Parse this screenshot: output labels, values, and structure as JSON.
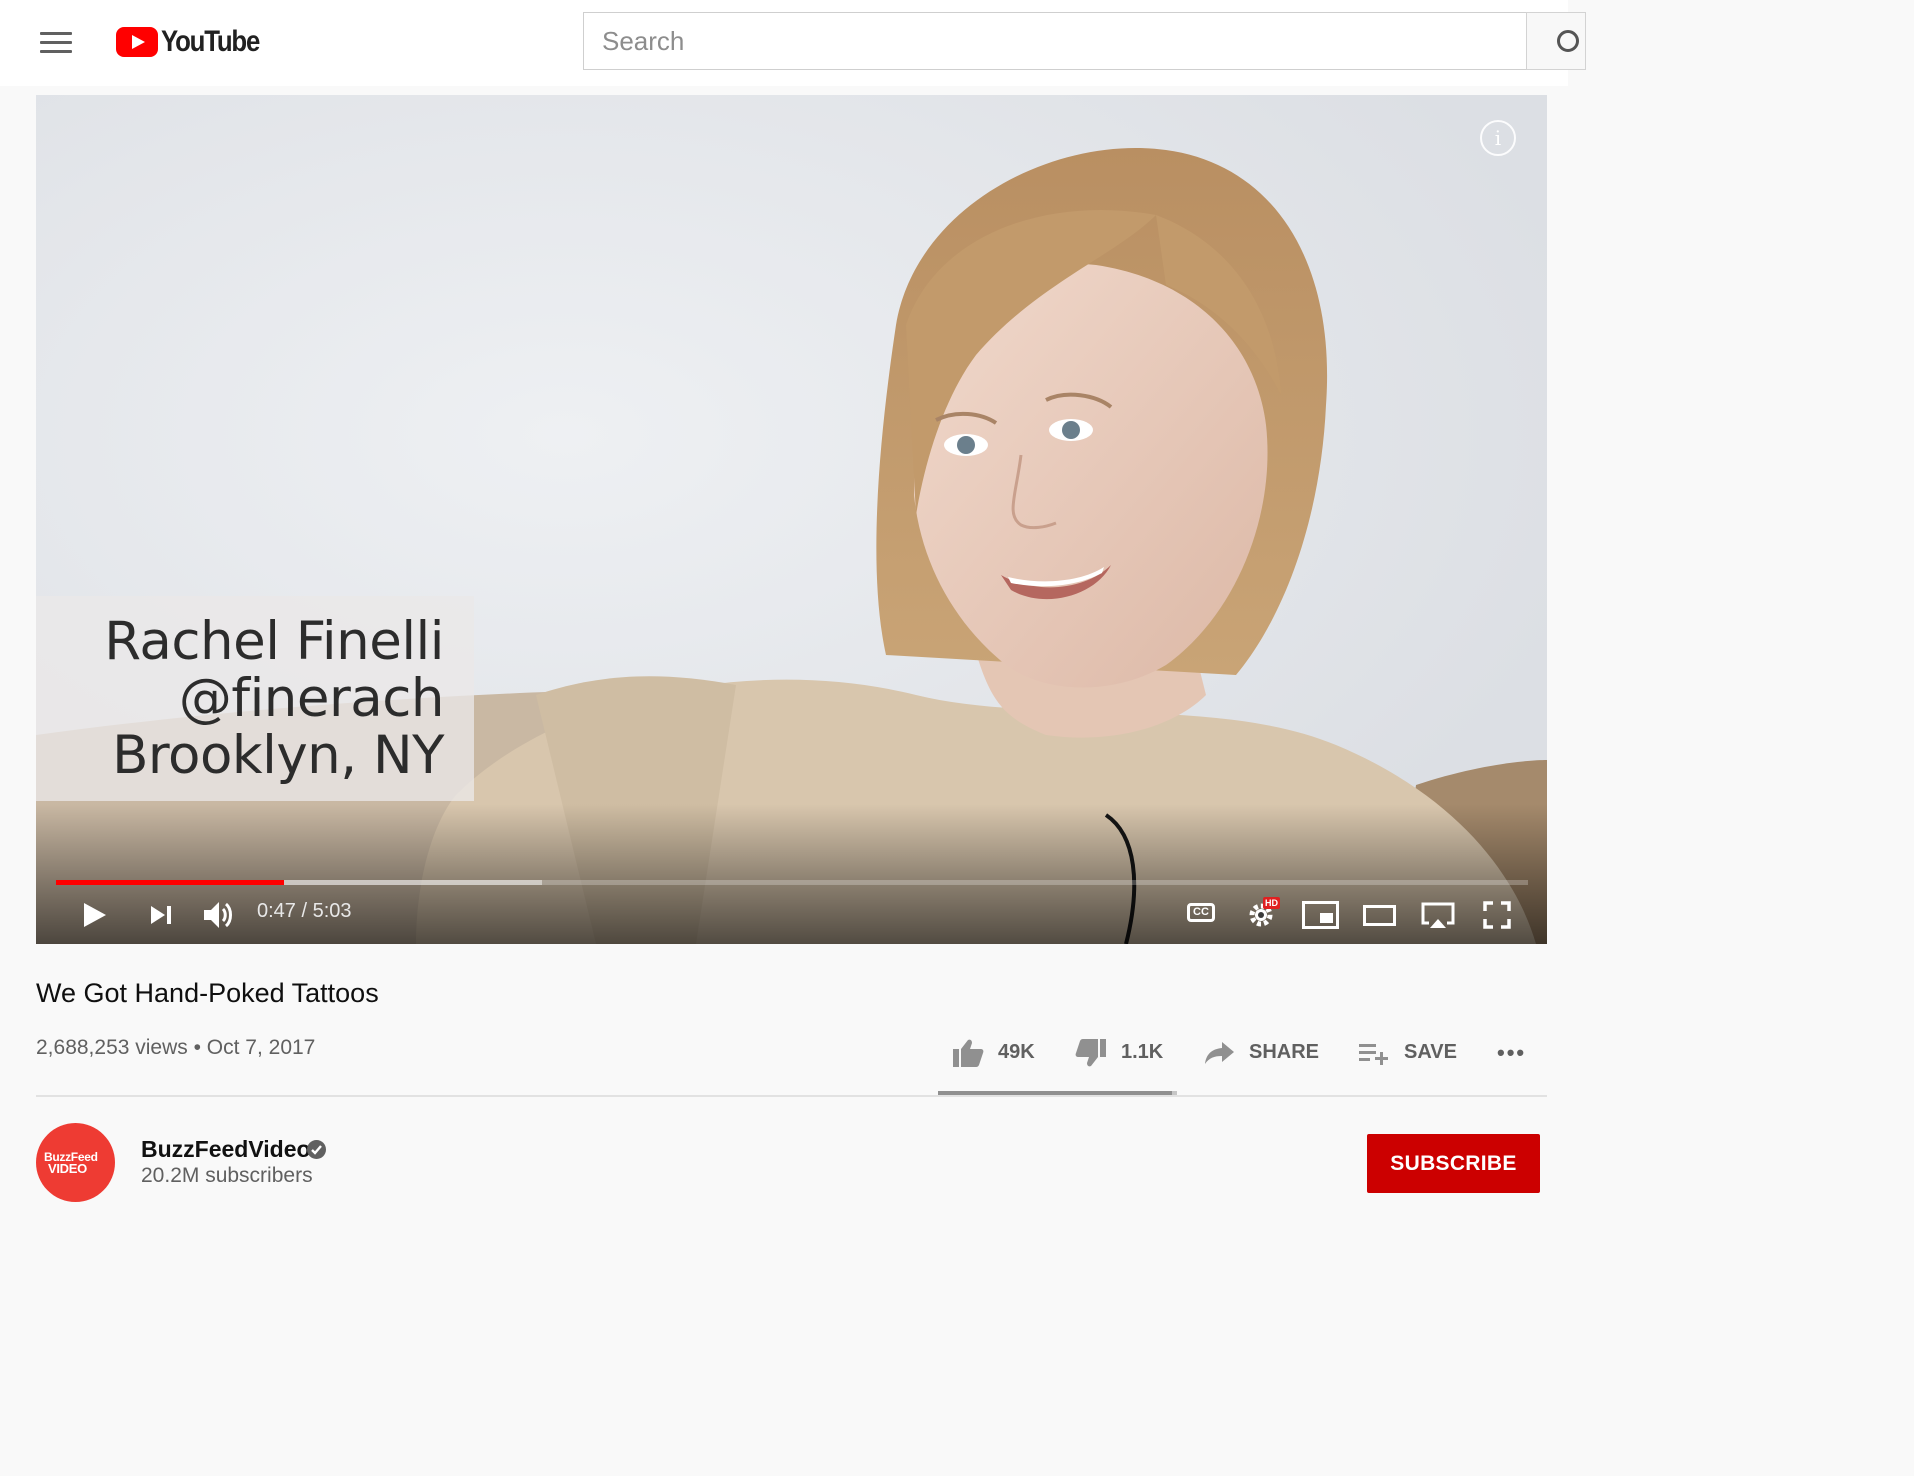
{
  "masthead": {
    "logo_text": "YouTube",
    "search_placeholder": "Search"
  },
  "player": {
    "lower_third": [
      "Rachel Finelli",
      "@finerach",
      "Brooklyn, NY"
    ],
    "info_label": "i",
    "current_time": "0:47",
    "duration": "5:03",
    "time_display": "0:47 / 5:03",
    "progress_fraction": 0.155,
    "buffered_fraction": 0.33,
    "cc_label": "CC",
    "quality_badge": "HD"
  },
  "video": {
    "title": "We Got Hand-Poked Tattoos",
    "views": "2,688,253 views",
    "separator": "•",
    "date": "Oct 7, 2017",
    "meta_line": "2,688,253 views • Oct 7, 2017",
    "likes": "49K",
    "dislikes": "1.1K",
    "share_label": "SHARE",
    "save_label": "SAVE",
    "more_label": "•••",
    "like_ratio": 0.978
  },
  "channel": {
    "name": "BuzzFeedVideo",
    "subscribers": "20.2M subscribers",
    "avatar_line1": "BuzzFeed",
    "avatar_line2": "VIDEO",
    "subscribe_label": "SUBSCRIBE"
  },
  "colors": {
    "brand_red": "#ff0000",
    "subscribe_red": "#cc0000",
    "avatar_red": "#ee3b33",
    "progress_red": "#ff0000"
  },
  "icons": [
    "menu-icon",
    "youtube-logo-icon",
    "search-icon",
    "info-icon",
    "play-icon",
    "next-icon",
    "volume-icon",
    "cc-icon",
    "settings-icon",
    "miniplayer-icon",
    "theater-icon",
    "airplay-icon",
    "fullscreen-icon",
    "like-icon",
    "dislike-icon",
    "share-icon",
    "save-icon",
    "more-icon",
    "verified-icon"
  ]
}
